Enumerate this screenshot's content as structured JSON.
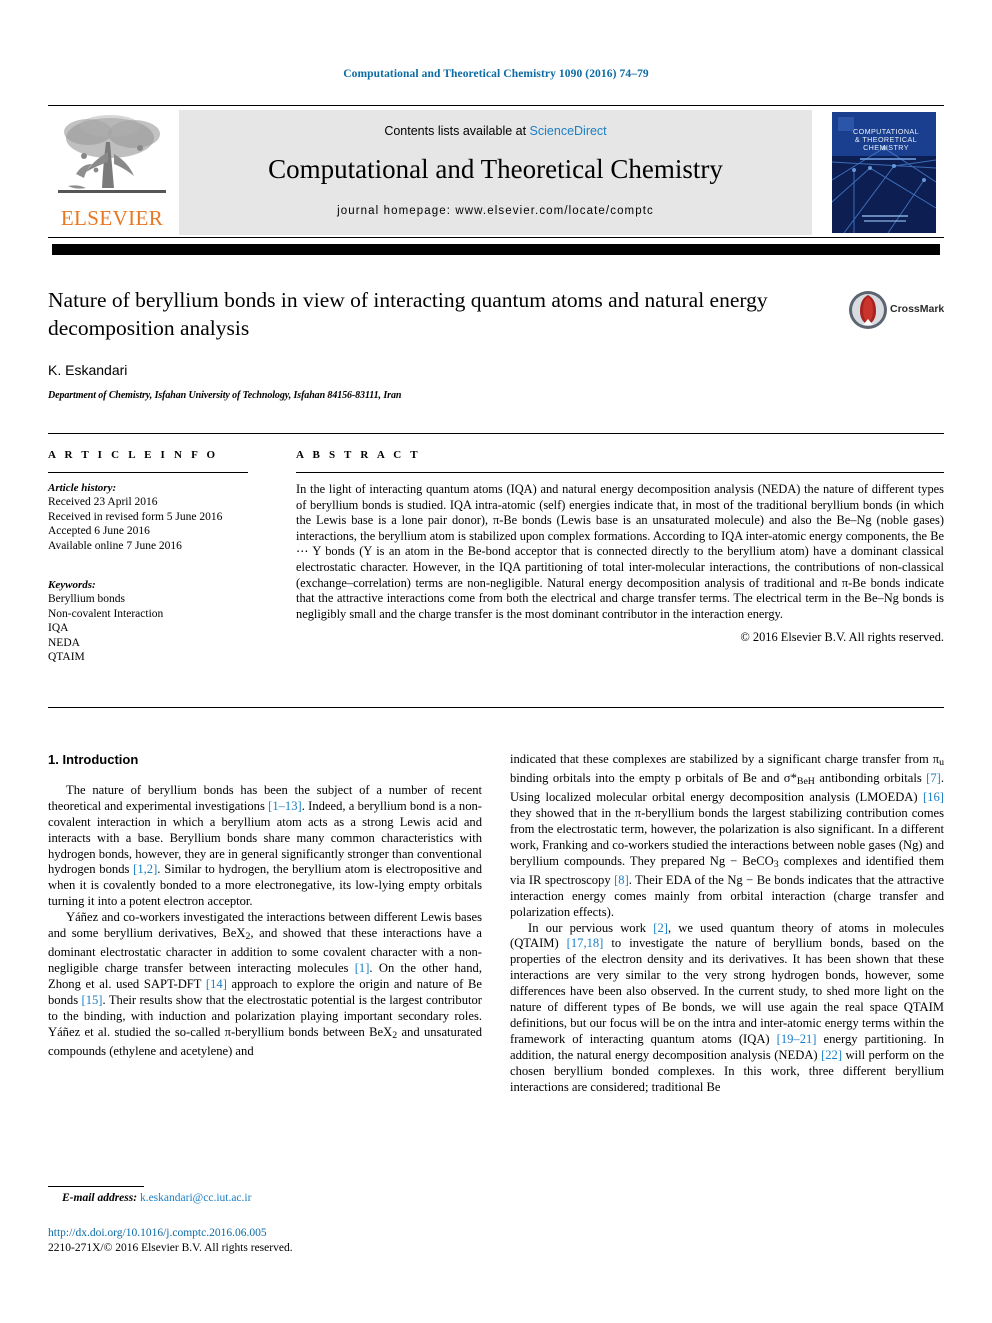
{
  "running_head": "Computational and Theoretical Chemistry 1090 (2016) 74–79",
  "header": {
    "contents_prefix": "Contents lists available at ",
    "sciencedirect": "ScienceDirect",
    "journal_title": "Computational and Theoretical Chemistry",
    "homepage": "journal homepage: www.elsevier.com/locate/comptc",
    "publisher": "ELSEVIER",
    "cover_title_line1": "COMPUTATIONAL",
    "cover_title_line2": "& THEORETICAL",
    "cover_title_line3": "CHEMISTRY",
    "crossmark_label": "CrossMark"
  },
  "article": {
    "title": "Nature of beryllium bonds in view of interacting quantum atoms and natural energy decomposition analysis",
    "authors": "K. Eskandari",
    "affiliation": "Department of Chemistry, Isfahan University of Technology, Isfahan 84156-83111, Iran"
  },
  "article_info": {
    "heading": "A R T I C L E  I N F O",
    "history_label": "Article history:",
    "history": [
      "Received 23 April 2016",
      "Received in revised form 5 June 2016",
      "Accepted 6 June 2016",
      "Available online 7 June 2016"
    ],
    "keywords_label": "Keywords:",
    "keywords": [
      "Beryllium bonds",
      "Non-covalent Interaction",
      "IQA",
      "NEDA",
      "QTAIM"
    ]
  },
  "abstract": {
    "heading": "A B S T R A C T",
    "text": "In the light of interacting quantum atoms (IQA) and natural energy decomposition analysis (NEDA) the nature of different types of beryllium bonds is studied. IQA intra-atomic (self) energies indicate that, in most of the traditional beryllium bonds (in which the Lewis base is a lone pair donor), π-Be bonds (Lewis base is an unsaturated molecule) and also the Be–Ng (noble gases) interactions, the beryllium atom is stabilized upon complex formations. According to IQA inter-atomic energy components, the Be ⋯ Y bonds (Y is an atom in the Be-bond acceptor that is connected directly to the beryllium atom) have a dominant classical electrostatic character. However, in the IQA partitioning of total inter-molecular interactions, the contributions of non-classical (exchange–correlation) terms are non-negligible. Natural energy decomposition analysis of traditional and π-Be bonds indicate that the attractive interactions come from both the electrical and charge transfer terms. The electrical term in the Be–Ng bonds is negligibly small and the charge transfer is the most dominant contributor in the interaction energy.",
    "copyright": "© 2016 Elsevier B.V. All rights reserved."
  },
  "body": {
    "section_heading": "1. Introduction",
    "left_paragraph_1_a": "The nature of beryllium bonds has been the subject of a number of recent theoretical and experimental investigations ",
    "left_ref_1_13": "[1–13]",
    "left_paragraph_1_b": ". Indeed, a beryllium bond is a non-covalent interaction in which a beryllium atom acts as a strong Lewis acid and interacts with a base. Beryllium bonds share many common characteristics with hydrogen bonds, however, they are in general significantly stronger than conventional hydrogen bonds ",
    "left_ref_1_2": "[1,2]",
    "left_paragraph_1_c": ". Similar to hydrogen, the beryllium atom is electropositive and when it is covalently bonded to a more electronegative, its low-lying empty orbitals turning it into a potent electron acceptor.",
    "left_paragraph_2_a": "Yáñez and co-workers investigated the interactions between different Lewis bases and some beryllium derivatives, BeX",
    "left_paragraph_2_b": ", and showed that these interactions have a dominant electrostatic character in addition to some covalent character with a non-negligible charge transfer between interacting molecules ",
    "left_ref_1": "[1]",
    "left_paragraph_2_c": ". On the other hand, Zhong et al. used SAPT-DFT ",
    "left_ref_14": "[14]",
    "left_paragraph_2_d": " approach to explore the origin and nature of Be bonds ",
    "left_ref_15": "[15]",
    "left_paragraph_2_e": ". Their results show that the electrostatic potential is the largest contributor to the binding, with induction and polarization playing important secondary roles. Yáñez et al. studied the so-called π-beryllium bonds between BeX",
    "left_paragraph_2_f": " and unsaturated compounds (ethylene and acetylene) and",
    "right_paragraph_1_a": "indicated that these complexes are stabilized by a significant charge transfer from π",
    "right_paragraph_1_b": " binding orbitals into the empty p orbitals of Be and σ*",
    "right_paragraph_1_c": " antibonding orbitals ",
    "right_ref_7": "[7]",
    "right_paragraph_1_d": ". Using localized molecular orbital energy decomposition analysis (LMOEDA) ",
    "right_ref_16": "[16]",
    "right_paragraph_1_e": " they showed that in the π-beryllium bonds the largest stabilizing contribution comes from the electrostatic term, however, the polarization is also significant. In a different work, Franking and co-workers studied the interactions between noble gases (Ng) and beryllium compounds. They prepared Ng − BeCO",
    "right_paragraph_1_f": " complexes and identified them via IR spectroscopy ",
    "right_ref_8": "[8]",
    "right_paragraph_1_g": ". Their EDA of the Ng − Be bonds indicates that the attractive interaction energy comes mainly from orbital interaction (charge transfer and polarization effects).",
    "right_paragraph_2_a": "In our pervious work ",
    "right_ref_2": "[2]",
    "right_paragraph_2_b": ", we used quantum theory of atoms in molecules (QTAIM) ",
    "right_ref_17_18": "[17,18]",
    "right_paragraph_2_c": " to investigate the nature of beryllium bonds, based on the properties of the electron density and its derivatives. It has been shown that these interactions are very similar to the very strong hydrogen bonds, however, some differences have been also observed. In the current study, to shed more light on the nature of different types of Be bonds, we will use again the real space QTAIM definitions, but our focus will be on the intra and inter-atomic energy terms within the framework of interacting quantum atoms (IQA) ",
    "right_ref_19_21": "[19–21]",
    "right_paragraph_2_d": " energy partitioning. In addition, the natural energy decomposition analysis (NEDA) ",
    "right_ref_22": "[22]",
    "right_paragraph_2_e": " will perform on the chosen beryllium bonded complexes. In this work, three different beryllium interactions are considered; traditional Be"
  },
  "footnote": {
    "label": "E-mail address:",
    "email": "k.eskandari@cc.iut.ac.ir"
  },
  "footer": {
    "doi": "http://dx.doi.org/10.1016/j.comptc.2016.06.005",
    "issn_line": "2210-271X/© 2016 Elsevier B.V. All rights reserved."
  },
  "colors": {
    "link_blue": "#1c7fc4",
    "header_blue": "#0b6ba4",
    "elsevier_orange": "#e87722",
    "panel_grey": "#e6e6e6"
  }
}
